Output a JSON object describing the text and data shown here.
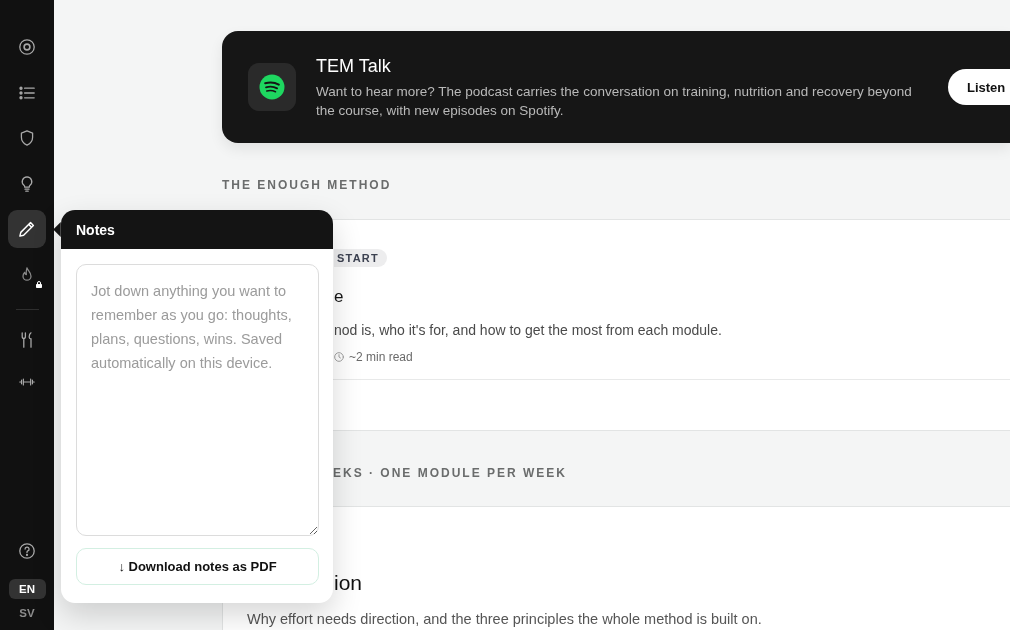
{
  "sidebar": {
    "main_items": [
      {
        "selected": false,
        "locked": false
      },
      {
        "selected": false,
        "locked": false
      },
      {
        "selected": false,
        "locked": false
      },
      {
        "selected": false,
        "locked": false
      },
      {
        "selected": true,
        "locked": false
      },
      {
        "selected": false,
        "locked": true
      }
    ],
    "tool_items": [
      {
        "selected": false
      },
      {
        "selected": false
      }
    ],
    "languages": [
      {
        "label": "EN",
        "selected": true
      },
      {
        "label": "SV",
        "selected": false
      }
    ]
  },
  "banner": {
    "title": "TEM Talk",
    "text": "Want to hear more? The podcast carries the conversation on training, nutrition and recovery beyond the course, with new episodes on Spotify.",
    "button": "Listen"
  },
  "sections": [
    {
      "heading": "THE ENOUGH METHOD",
      "card": {
        "badge": "START",
        "title": "e",
        "description": "nod is, who it's for, and how to get the most from each module.",
        "meta": "~2 min read"
      }
    },
    {
      "heading": "EKS · ONE MODULE PER WEEK",
      "card": {
        "title": "ion",
        "description": "Why effort needs direction, and the three principles the whole method is built on."
      }
    }
  ],
  "notes": {
    "title": "Notes",
    "placeholder": "Jot down anything you want to remember as you go: thoughts, plans, questions, wins. Saved automatically on this device.",
    "button": "↓ Download notes as PDF"
  }
}
